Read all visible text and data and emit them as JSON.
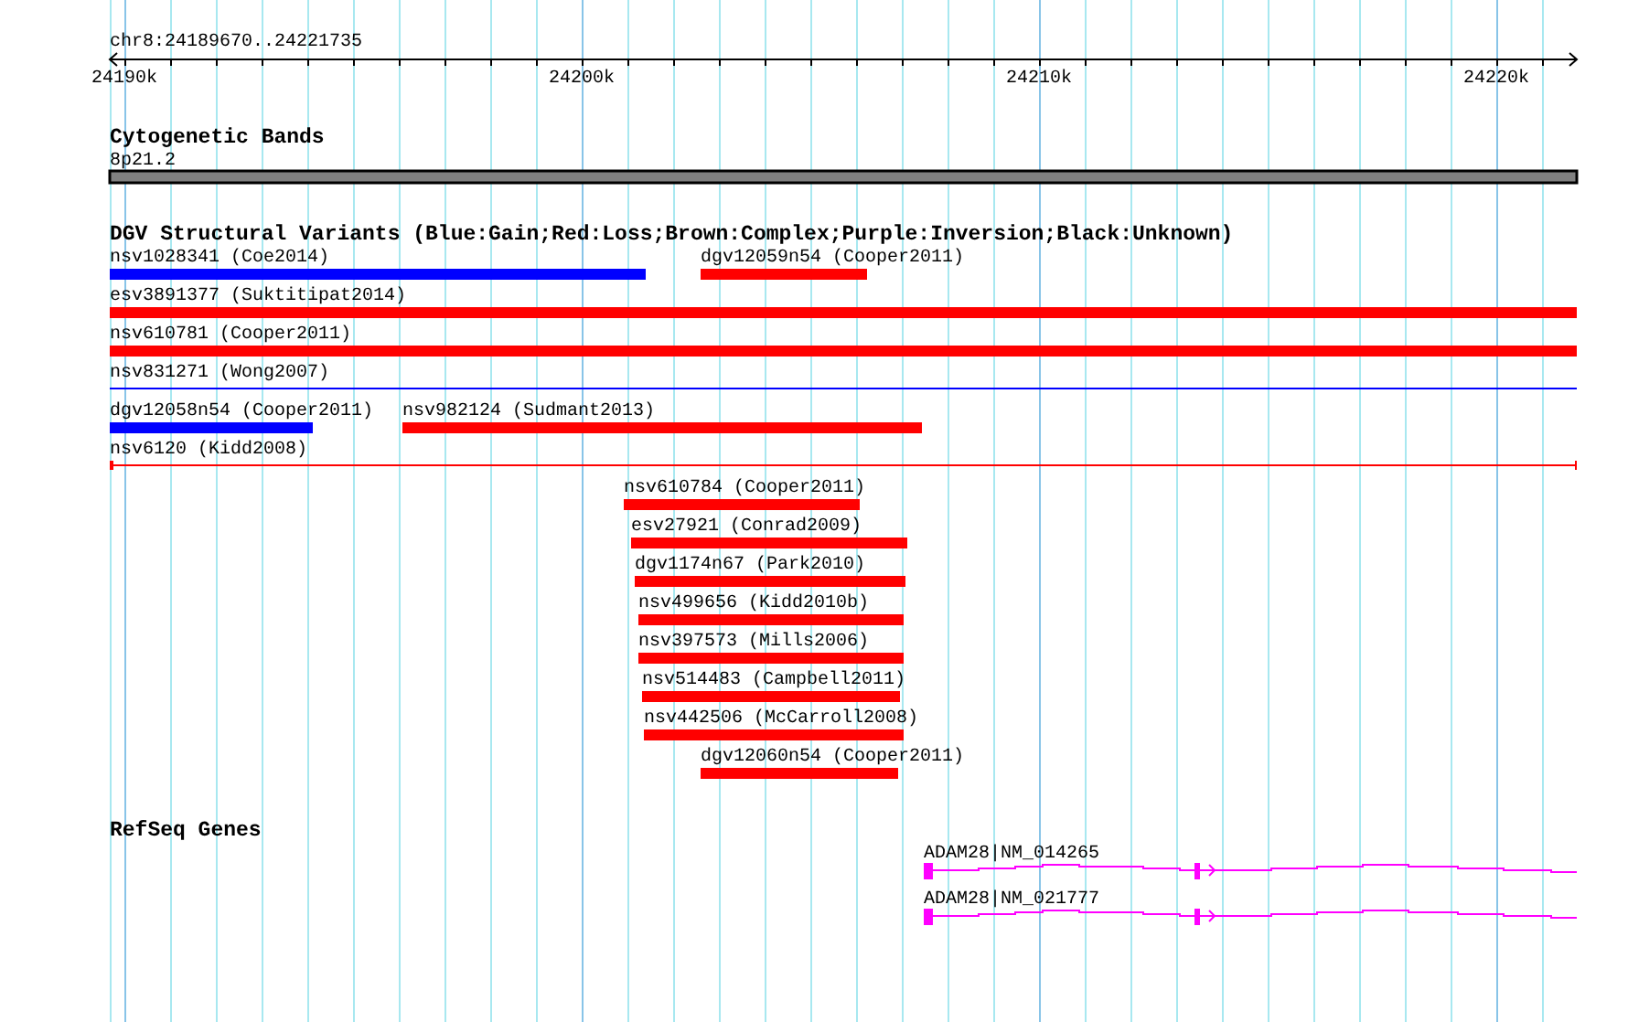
{
  "location": "chr8:24189670..24221735",
  "ruler": {
    "ticks": [
      "24190k",
      "24200k",
      "24210k",
      "24220k"
    ]
  },
  "tracks": [
    {
      "kind": "cytoband",
      "title": "Cytogenetic Bands",
      "features": [
        {
          "label": "8p21.2",
          "color": "#808080"
        }
      ]
    },
    {
      "kind": "variants",
      "title": "DGV Structural Variants (Blue:Gain;Red:Loss;Brown:Complex;Purple:Inversion;Black:Unknown)",
      "features": [
        {
          "label": "nsv1028341 (Coe2014)",
          "kind": "bar",
          "color": "#0000ff"
        },
        {
          "label": "dgv12059n54 (Cooper2011)",
          "kind": "bar",
          "color": "#ff0000"
        },
        {
          "label": "esv3891377 (Suktitipat2014)",
          "kind": "bar",
          "color": "#ff0000"
        },
        {
          "label": "nsv610781 (Cooper2011)",
          "kind": "bar",
          "color": "#ff0000"
        },
        {
          "label": "nsv831271 (Wong2007)",
          "kind": "line",
          "color": "#0000ff"
        },
        {
          "label": "dgv12058n54 (Cooper2011)",
          "kind": "bar",
          "color": "#0000ff"
        },
        {
          "label": "nsv982124 (Sudmant2013)",
          "kind": "bar",
          "color": "#ff0000"
        },
        {
          "label": "nsv6120 (Kidd2008)",
          "kind": "span",
          "color": "#ff0000"
        },
        {
          "label": "nsv610784 (Cooper2011)",
          "kind": "bar",
          "color": "#ff0000"
        },
        {
          "label": "esv27921 (Conrad2009)",
          "kind": "bar",
          "color": "#ff0000"
        },
        {
          "label": "dgv1174n67 (Park2010)",
          "kind": "bar",
          "color": "#ff0000"
        },
        {
          "label": "nsv499656 (Kidd2010b)",
          "kind": "bar",
          "color": "#ff0000"
        },
        {
          "label": "nsv397573 (Mills2006)",
          "kind": "bar",
          "color": "#ff0000"
        },
        {
          "label": "nsv514483 (Campbell2011)",
          "kind": "bar",
          "color": "#ff0000"
        },
        {
          "label": "nsv442506 (McCarroll2008)",
          "kind": "bar",
          "color": "#ff0000"
        },
        {
          "label": "dgv12060n54 (Cooper2011)",
          "kind": "bar",
          "color": "#ff0000"
        }
      ]
    },
    {
      "kind": "genes",
      "title": "RefSeq Genes",
      "features": [
        {
          "label": "ADAM28|NM_014265"
        },
        {
          "label": "ADAM28|NM_021777"
        }
      ]
    }
  ]
}
